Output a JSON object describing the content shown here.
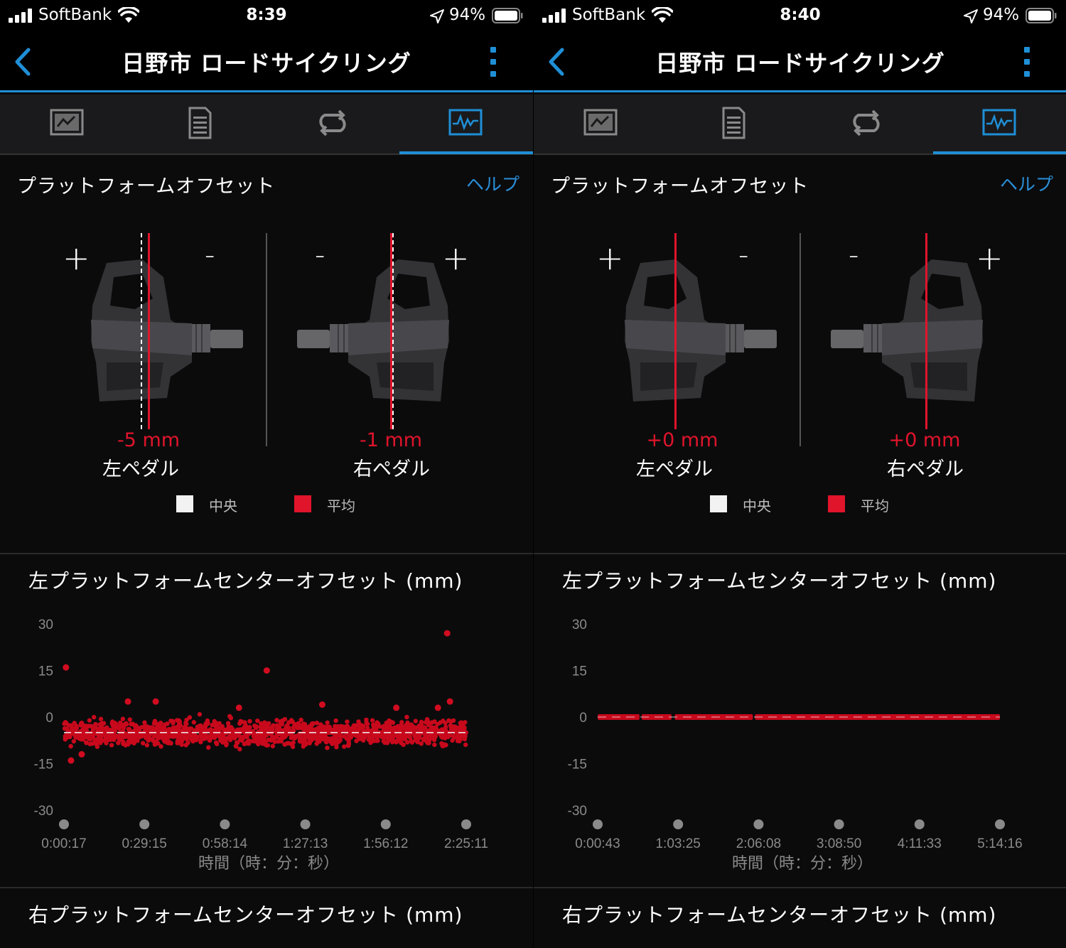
{
  "colors": {
    "accent": "#1f8fd6",
    "average_red": "#e0142b",
    "center_white": "#f2f2f2",
    "background": "#0b0b0c"
  },
  "screens": [
    {
      "status": {
        "carrier": "SoftBank",
        "time": "8:39",
        "battery": "94%"
      },
      "nav": {
        "title": "日野市 ロードサイクリング",
        "back_icon": "chevron-left-icon",
        "more_icon": "vertical-dots-icon"
      },
      "tabs": [
        {
          "icon": "chart-summary-icon",
          "selected": false
        },
        {
          "icon": "document-list-icon",
          "selected": false
        },
        {
          "icon": "laps-loop-icon",
          "selected": false
        },
        {
          "icon": "activity-graph-icon",
          "selected": true
        }
      ],
      "section": {
        "title": "プラットフォームオフセット",
        "help": "ヘルプ"
      },
      "left_pedal": {
        "plus": "+",
        "minus": "-",
        "value_mm": -5,
        "value_label": "-5 mm",
        "name": "左ペダル"
      },
      "right_pedal": {
        "plus": "+",
        "minus": "-",
        "value_mm": -1,
        "value_label": "-1 mm",
        "name": "右ペダル"
      },
      "legend": [
        {
          "label": "中央",
          "color": "#f2f2f2"
        },
        {
          "label": "平均",
          "color": "#e0142b"
        }
      ],
      "chart_data": {
        "type": "scatter",
        "title": "左プラットフォームセンターオフセット (mm)",
        "xlabel": "時間（時：分：秒）",
        "ylabel": "",
        "yticks": [
          30,
          15,
          0,
          -15,
          -30
        ],
        "ylim": [
          -30,
          30
        ],
        "xticks": [
          "0:00:17",
          "0:29:15",
          "0:58:14",
          "1:27:13",
          "1:56:12",
          "2:25:11"
        ],
        "x_seconds": [
          17,
          8711
        ],
        "mean": -5,
        "band": [
          -10,
          0
        ],
        "outliers": [
          [
            60,
            16
          ],
          [
            170,
            -14
          ],
          [
            400,
            -12
          ],
          [
            4400,
            15
          ],
          [
            8300,
            27
          ],
          [
            8100,
            3
          ],
          [
            8360,
            5
          ],
          [
            1400,
            5
          ],
          [
            2000,
            5
          ],
          [
            3800,
            3
          ],
          [
            5600,
            4
          ],
          [
            7200,
            3
          ]
        ]
      },
      "next_section_title": "右プラットフォームセンターオフセット (mm)"
    },
    {
      "status": {
        "carrier": "SoftBank",
        "time": "8:40",
        "battery": "94%"
      },
      "nav": {
        "title": "日野市 ロードサイクリング",
        "back_icon": "chevron-left-icon",
        "more_icon": "vertical-dots-icon"
      },
      "tabs": [
        {
          "icon": "chart-summary-icon",
          "selected": false
        },
        {
          "icon": "document-list-icon",
          "selected": false
        },
        {
          "icon": "laps-loop-icon",
          "selected": false
        },
        {
          "icon": "activity-graph-icon",
          "selected": true
        }
      ],
      "section": {
        "title": "プラットフォームオフセット",
        "help": "ヘルプ"
      },
      "left_pedal": {
        "plus": "+",
        "minus": "-",
        "value_mm": 0,
        "value_label": "+0 mm",
        "name": "左ペダル"
      },
      "right_pedal": {
        "plus": "+",
        "minus": "-",
        "value_mm": 0,
        "value_label": "+0 mm",
        "name": "右ペダル"
      },
      "legend": [
        {
          "label": "中央",
          "color": "#f2f2f2"
        },
        {
          "label": "平均",
          "color": "#e0142b"
        }
      ],
      "chart_data": {
        "type": "line",
        "title": "左プラットフォームセンターオフセット (mm)",
        "xlabel": "時間（時：分：秒）",
        "ylabel": "",
        "yticks": [
          30,
          15,
          0,
          -15,
          -30
        ],
        "ylim": [
          -30,
          30
        ],
        "xticks": [
          "0:00:43",
          "1:03:25",
          "2:06:08",
          "3:08:50",
          "4:11:33",
          "5:14:16"
        ],
        "x_seconds": [
          43,
          18856
        ],
        "mean": 0,
        "segments": [
          [
            43,
            2000
          ],
          [
            2100,
            3500
          ],
          [
            3650,
            7300
          ],
          [
            7400,
            18856
          ]
        ]
      },
      "next_section_title": "右プラットフォームセンターオフセット (mm)"
    }
  ]
}
